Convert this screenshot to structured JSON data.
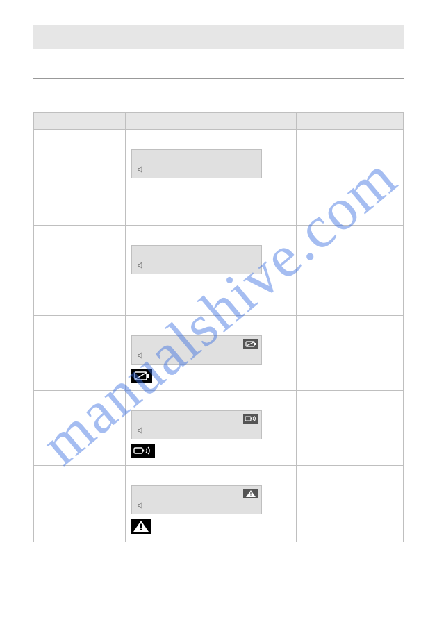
{
  "watermark": "manualshive.com",
  "icons": {
    "speaker": "speaker-icon",
    "battery": "battery-icon",
    "battery_sound": "battery-sound-icon",
    "warning": "warning-icon"
  },
  "table": {
    "headers": [
      "",
      "",
      ""
    ],
    "rows": [
      {
        "col1": "",
        "display": {
          "speaker": true,
          "badge": null
        },
        "below": null,
        "col3": ""
      },
      {
        "col1": "",
        "display": {
          "speaker": true,
          "badge": null
        },
        "below": null,
        "col3": ""
      },
      {
        "col1": "",
        "display": {
          "speaker": true,
          "badge": "battery"
        },
        "below": "battery",
        "col3": ""
      },
      {
        "col1": "",
        "display": {
          "speaker": true,
          "badge": "battery_sound"
        },
        "below": "battery_sound",
        "col3": ""
      },
      {
        "col1": "",
        "display": {
          "speaker": true,
          "badge": "warning"
        },
        "below": "warning",
        "col3": ""
      }
    ]
  }
}
